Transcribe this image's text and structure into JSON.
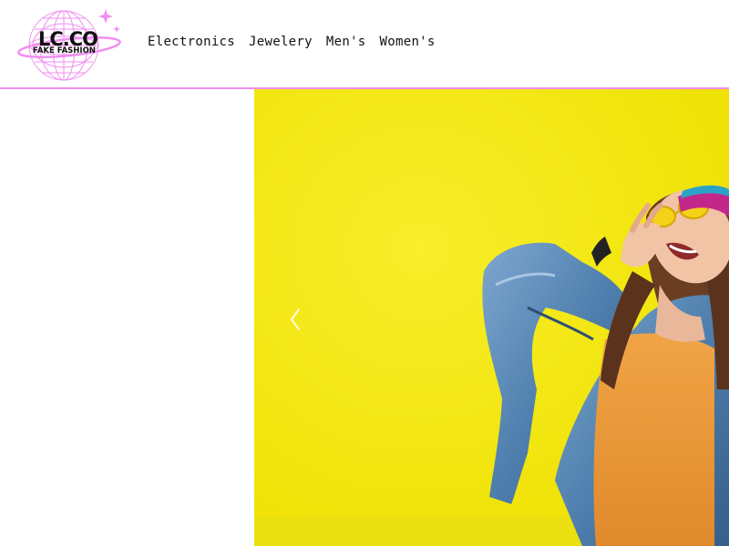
{
  "brand": {
    "logo_main": "LC.CO",
    "logo_sub": "FAKE FASHION",
    "accent_color": "#f08ef0"
  },
  "nav": {
    "items": [
      {
        "label": "Electronics"
      },
      {
        "label": "Jewelery"
      },
      {
        "label": "Men's"
      },
      {
        "label": "Women's"
      }
    ]
  },
  "carousel": {
    "prev_icon": "chevron-left-icon",
    "background_color": "#f3e80e",
    "slide_image": "woman-in-denim-jacket-laughing-photo"
  }
}
